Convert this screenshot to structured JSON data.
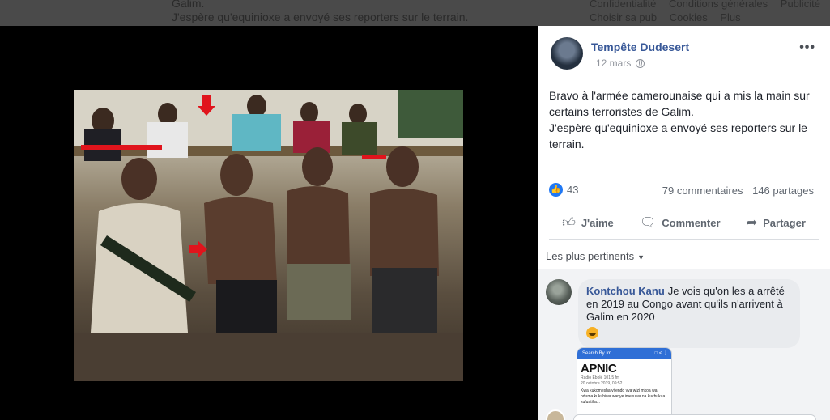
{
  "background": {
    "post_line_1": "Galim.",
    "post_line_2": "J'espère qu'equinioxe a envoyé ses reporters sur le terrain.",
    "footer_links": [
      "Confidentialité",
      "Conditions générales",
      "Publicité",
      "Choisir sa pub",
      "Cookies",
      "Plus"
    ]
  },
  "post": {
    "author": "Tempête Dudesert",
    "date": "12 mars",
    "more_label": "•••",
    "text": "Bravo à l'armée camerounaise qui a mis la main sur certains terroristes de Galim.\nJ'espère qu'equinioxe a envoyé ses reporters sur le terrain.",
    "reactions_count": "43",
    "comments_count": "79 commentaires",
    "shares_count": "146 partages"
  },
  "actions": {
    "like": "J'aime",
    "comment": "Commenter",
    "share": "Partager"
  },
  "comments": {
    "sort_label": "Les plus pertinents",
    "items": [
      {
        "name": "Kontchou Kanu",
        "text": "Je vois qu'on les a arrêté en 2019 au Congo avant qu'ils n'arrivent à Galim en 2020"
      }
    ],
    "attachment": {
      "bar_title": "Search By Im...",
      "logo": "APNIC",
      "source": "Radio Ebolé 101.5 fm",
      "date": "20 octobre 2019, 09:52",
      "body": "Kwa kukomesha vitendo vya wizi mkoa wa nduma kukubiwa wanye imekuwa na kuchukua kufuatilia..."
    }
  },
  "colors": {
    "link": "#385898",
    "like_blue": "#2078f4",
    "theater_bg": "#000000"
  },
  "icons": [
    "globe-icon",
    "like-reaction-icon",
    "thumbs-up-icon",
    "comment-icon",
    "share-icon",
    "laugh-emoji-icon"
  ]
}
